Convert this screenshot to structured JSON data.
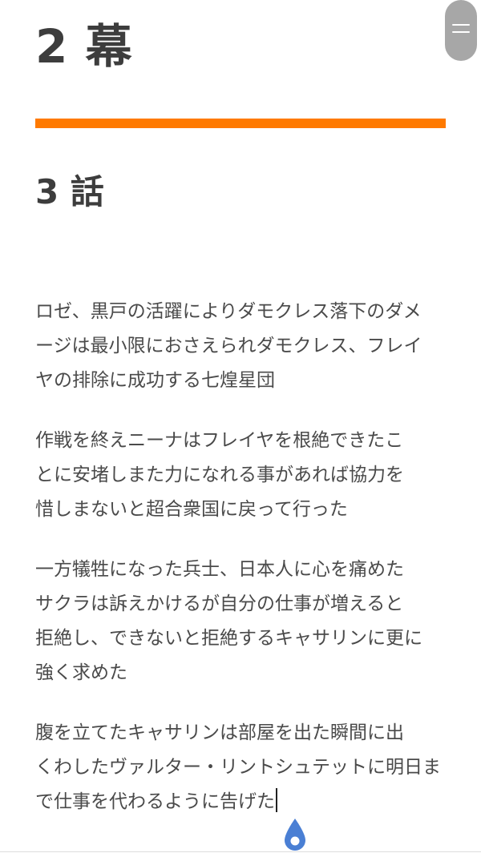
{
  "header": {
    "chapter_title": "2 幕",
    "menu_icon": "hamburger-menu-icon"
  },
  "section": {
    "episode_title": "3 話"
  },
  "story": {
    "paragraphs": [
      {
        "lines": [
          "ロゼ、黒戸の活躍によりダモクレス落下のダメ",
          "ージは最小限におさえられダモクレス、フレイ",
          "ヤの排除に成功する七煌星団"
        ]
      },
      {
        "lines": [
          "作戦を終えニーナはフレイヤを根絶できたこ",
          "とに安堵しまた力になれる事があれば協力を",
          "惜しまないと超合衆国に戻って行った"
        ]
      },
      {
        "lines": [
          "一方犠牲になった兵士、日本人に心を痛めた",
          "サクラは訴えかけるが自分の仕事が増えると",
          "拒絶し、できないと拒絶するキャサリンに更に",
          "強く求めた"
        ]
      },
      {
        "lines": [
          "腹を立てたキャサリンは部屋を出た瞬間に出",
          "くわしたヴァルター・リントシュテットに明日ま",
          "で仕事を代わるように告げた"
        ]
      }
    ]
  },
  "colors": {
    "accent": "#ff7a00",
    "caret_handle": "#4a7fd4",
    "menu_button": "#9e9e9e",
    "text": "#4a4a4a"
  }
}
